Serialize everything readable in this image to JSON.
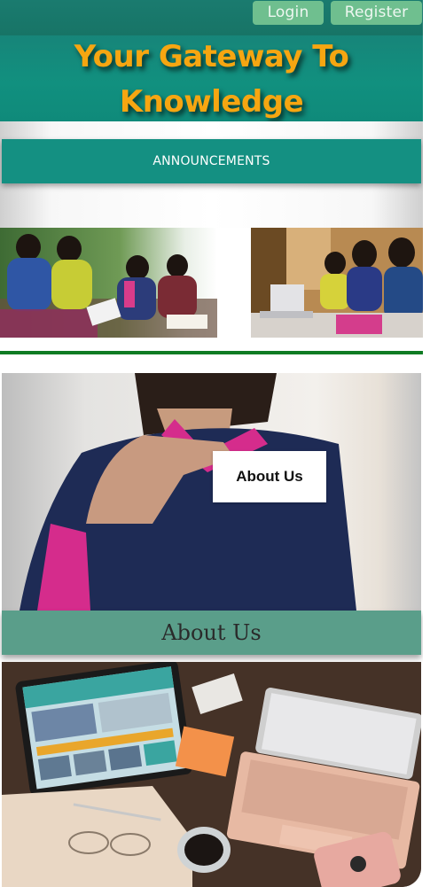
{
  "header": {
    "login_label": "Login",
    "register_label": "Register",
    "title_line1": "Your Gateway To",
    "title_line2": "Knowledge"
  },
  "announcements": {
    "label": "ANNOUNCEMENTS"
  },
  "about": {
    "card_text": "About Us",
    "heading": "About Us"
  },
  "colors": {
    "header_teal": "#177466",
    "title_orange": "#f6a611",
    "button_green": "#6fbf8f",
    "announce_teal": "#149082",
    "about_band": "#5a9e8a",
    "divider_green": "#0f7b23"
  }
}
